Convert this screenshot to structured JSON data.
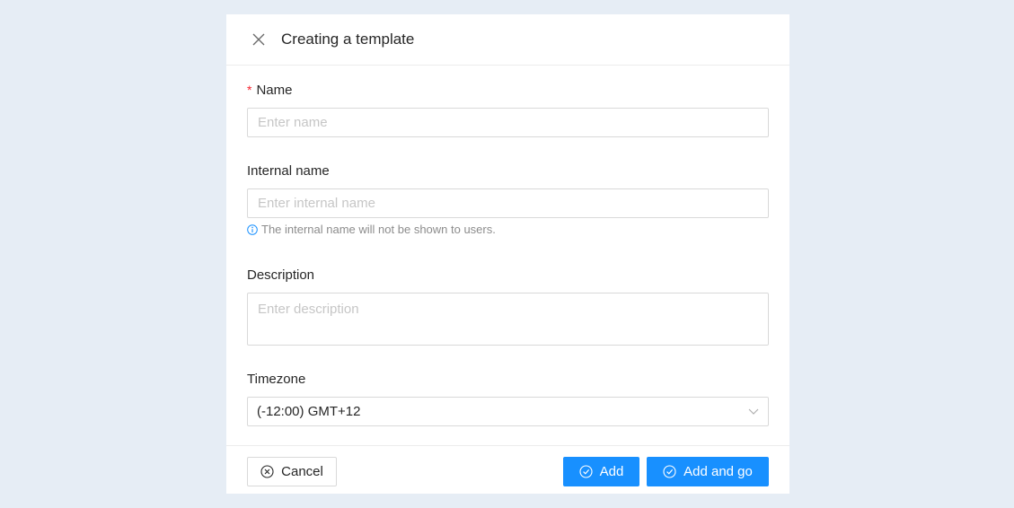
{
  "modal": {
    "title": "Creating a template",
    "close_icon": "close-icon"
  },
  "form": {
    "name": {
      "label": "Name",
      "required_mark": "*",
      "placeholder": "Enter name",
      "value": ""
    },
    "internal_name": {
      "label": "Internal name",
      "placeholder": "Enter internal name",
      "value": "",
      "hint": "The internal name will not be shown to users.",
      "hint_icon": "info-icon"
    },
    "description": {
      "label": "Description",
      "placeholder": "Enter description",
      "value": ""
    },
    "timezone": {
      "label": "Timezone",
      "selected": "(-12:00) GMT+12",
      "dropdown_icon": "chevron-down-icon"
    }
  },
  "footer": {
    "cancel_label": "Cancel",
    "add_label": "Add",
    "add_and_go_label": "Add and go"
  },
  "colors": {
    "background": "#e6edf5",
    "primary": "#1890ff",
    "required": "#f5222d",
    "hint": "#8c8c8c"
  }
}
